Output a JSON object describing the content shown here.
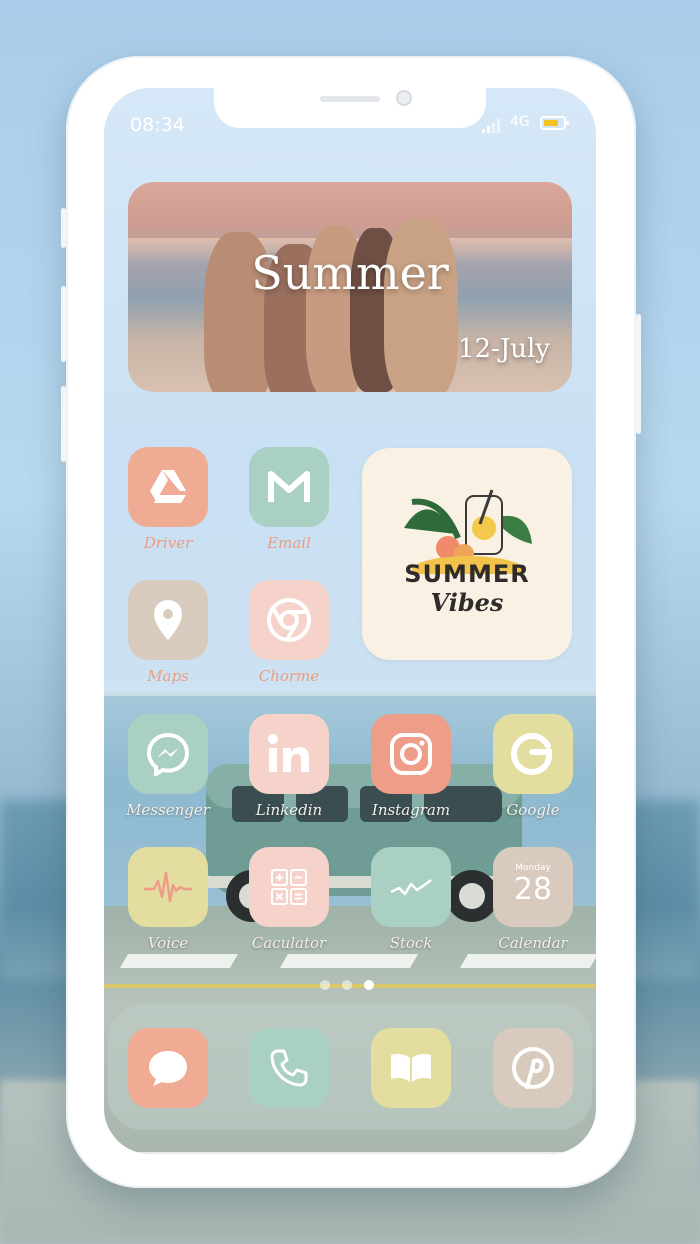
{
  "status_bar": {
    "time": "08:34",
    "network": "4G"
  },
  "widgets": {
    "photo": {
      "title": "Summer",
      "date": "12-July"
    },
    "sticker": {
      "line1": "SUMMER",
      "line2": "Vibes"
    }
  },
  "apps": {
    "driver": "Driver",
    "email": "Email",
    "maps": "Maps",
    "chrome": "Chorme",
    "messenger": "Messenger",
    "linkedin": "Linkedin",
    "instagram": "Instagram",
    "google": "Google",
    "voice": "Voice",
    "calculator": "Caculator",
    "stock": "Stock",
    "calendar": "Calendar",
    "calendar_day": "Monday",
    "calendar_date": "28"
  },
  "page_indicator": {
    "pages": 3,
    "current": 3
  },
  "colors": {
    "peach": "#efab93",
    "mint": "#a9d0c3",
    "sand": "#d8cbbe",
    "blush": "#f5d3cb",
    "salmon": "#ee9d88",
    "butter": "#e3dd9f",
    "label": "#ee9b7f"
  }
}
